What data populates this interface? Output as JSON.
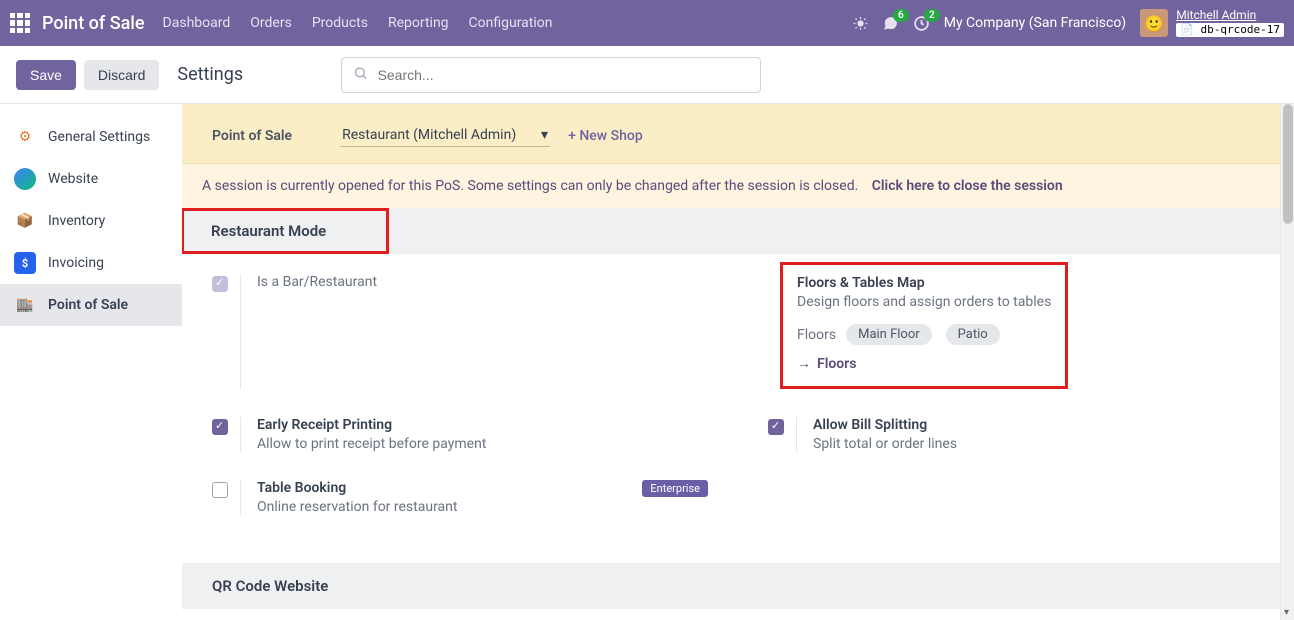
{
  "topnav": {
    "brand": "Point of Sale",
    "items": [
      "Dashboard",
      "Orders",
      "Products",
      "Reporting",
      "Configuration"
    ],
    "chat_badge": "6",
    "activity_badge": "2",
    "company": "My Company (San Francisco)",
    "user_name": "Mitchell Admin",
    "db_name": "db-qrcode-17"
  },
  "actions": {
    "save": "Save",
    "discard": "Discard",
    "page_title": "Settings",
    "search_placeholder": "Search..."
  },
  "sidebar": {
    "items": [
      {
        "label": "General Settings"
      },
      {
        "label": "Website"
      },
      {
        "label": "Inventory"
      },
      {
        "label": "Invoicing"
      },
      {
        "label": "Point of Sale"
      }
    ]
  },
  "posbar": {
    "label": "Point of Sale",
    "selected": "Restaurant (Mitchell Admin)",
    "new_shop": "+ New Shop"
  },
  "warning": {
    "text": "A session is currently opened for this PoS. Some settings can only be changed after the session is closed.",
    "link": "Click here to close the session"
  },
  "sections": {
    "restaurant_mode": {
      "title": "Restaurant Mode",
      "is_bar": {
        "label": "Is a Bar/Restaurant"
      },
      "floors_map": {
        "title": "Floors & Tables Map",
        "desc": "Design floors and assign orders to tables",
        "floors_label": "Floors",
        "tags": [
          "Main Floor",
          "Patio"
        ],
        "link": "Floors"
      },
      "early_receipt": {
        "title": "Early Receipt Printing",
        "desc": "Allow to print receipt before payment"
      },
      "bill_split": {
        "title": "Allow Bill Splitting",
        "desc": "Split total or order lines"
      },
      "table_booking": {
        "title": "Table Booking",
        "desc": "Online reservation for restaurant",
        "badge": "Enterprise"
      }
    },
    "qr": {
      "title": "QR Code Website"
    }
  }
}
